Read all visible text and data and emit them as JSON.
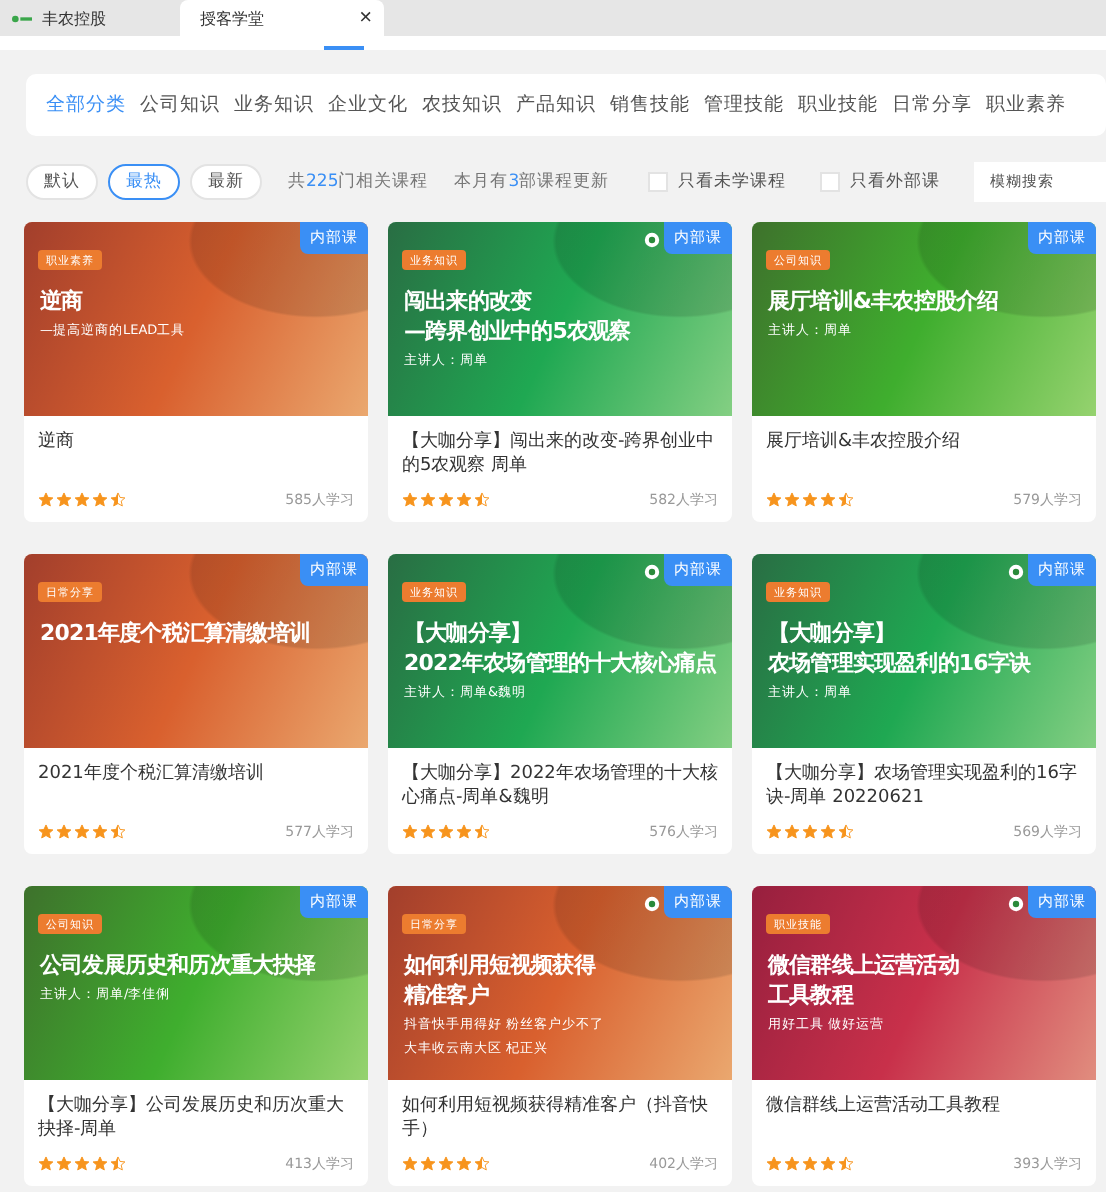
{
  "window_tabs": [
    {
      "label": "丰农控股",
      "selected": false,
      "has_logo": true
    },
    {
      "label": "授客学堂",
      "selected": true,
      "has_logo": false
    }
  ],
  "close_symbol": "×",
  "categories": [
    {
      "label": "全部分类",
      "selected": true
    },
    {
      "label": "公司知识",
      "selected": false
    },
    {
      "label": "业务知识",
      "selected": false
    },
    {
      "label": "企业文化",
      "selected": false
    },
    {
      "label": "农技知识",
      "selected": false
    },
    {
      "label": "产品知识",
      "selected": false
    },
    {
      "label": "销售技能",
      "selected": false
    },
    {
      "label": "管理技能",
      "selected": false
    },
    {
      "label": "职业技能",
      "selected": false
    },
    {
      "label": "日常分享",
      "selected": false
    },
    {
      "label": "职业素养",
      "selected": false
    }
  ],
  "sort_buttons": [
    {
      "label": "默认",
      "selected": false
    },
    {
      "label": "最热",
      "selected": true
    },
    {
      "label": "最新",
      "selected": false
    }
  ],
  "total": {
    "prefix": "共",
    "number": "225",
    "suffix": "门相关课程"
  },
  "monthly": {
    "prefix": "本月有",
    "number": "3",
    "suffix": "部课程更新"
  },
  "filters": [
    {
      "label": "只看未学课程",
      "checked": false
    },
    {
      "label": "只看外部课",
      "checked": false
    }
  ],
  "search_mode": {
    "value": "模糊搜索"
  },
  "courses": [
    {
      "cover": {
        "color": "#d9602e",
        "tag": "职业素养",
        "badge": "内部课",
        "has_logo": false,
        "lines": [
          "逆商"
        ],
        "sub": [
          "—提高逆商的LEAD工具"
        ]
      },
      "title": "逆商",
      "stars": 4.5,
      "learners": "585人学习"
    },
    {
      "cover": {
        "color": "#1fa852",
        "tag": "业务知识",
        "badge": "内部课",
        "has_logo": true,
        "lines": [
          "闯出来的改变",
          "—跨界创业中的5农观察"
        ],
        "sub": [
          "主讲人：周单"
        ]
      },
      "title": "【大咖分享】闯出来的改变-跨界创业中的5农观察 周单",
      "stars": 4.5,
      "learners": "582人学习"
    },
    {
      "cover": {
        "color": "#3fae2e",
        "tag": "公司知识",
        "badge": "内部课",
        "has_logo": false,
        "lines": [
          "展厅培训&丰农控股介绍"
        ],
        "sub": [
          "主讲人：周单"
        ]
      },
      "title": "展厅培训&丰农控股介绍",
      "stars": 4.5,
      "learners": "579人学习"
    },
    {
      "cover": {
        "color": "#d9602e",
        "tag": "日常分享",
        "badge": "内部课",
        "has_logo": false,
        "lines": [
          "2021年度个税汇算清缴培训"
        ]
      },
      "title": "2021年度个税汇算清缴培训",
      "stars": 4.5,
      "learners": "577人学习"
    },
    {
      "cover": {
        "color": "#1fa852",
        "tag": "业务知识",
        "badge": "内部课",
        "has_logo": true,
        "lines": [
          "【大咖分享】",
          "2022年农场管理的十大核心痛点"
        ],
        "sub": [
          "主讲人：周单&魏明"
        ]
      },
      "title": "【大咖分享】2022年农场管理的十大核心痛点-周单&魏明",
      "stars": 4.5,
      "learners": "576人学习"
    },
    {
      "cover": {
        "color": "#1fa852",
        "tag": "业务知识",
        "badge": "内部课",
        "has_logo": true,
        "lines": [
          "【大咖分享】",
          "农场管理实现盈利的16字诀"
        ],
        "sub": [
          "主讲人：周单"
        ]
      },
      "title": "【大咖分享】农场管理实现盈利的16字诀-周单 20220621",
      "stars": 4.5,
      "learners": "569人学习"
    },
    {
      "cover": {
        "color": "#3fae2e",
        "tag": "公司知识",
        "badge": "内部课",
        "has_logo": false,
        "lines": [
          "公司发展历史和历次重大抉择"
        ],
        "sub": [
          "主讲人：周单/李佳俐"
        ]
      },
      "title": "【大咖分享】公司发展历史和历次重大抉择-周单",
      "stars": 4.5,
      "learners": "413人学习"
    },
    {
      "cover": {
        "color": "#d9602e",
        "tag": "日常分享",
        "badge": "内部课",
        "has_logo": true,
        "lines": [
          "如何利用短视频获得",
          "精准客户"
        ],
        "sub": [
          "抖音快手用得好  粉丝客户少不了",
          "大丰收云南大区  杞正兴"
        ]
      },
      "title": "如何利用短视频获得精准客户（抖音快手）",
      "stars": 4.5,
      "learners": "402人学习"
    },
    {
      "cover": {
        "color": "#c8304a",
        "tag": "职业技能",
        "badge": "内部课",
        "has_logo": true,
        "lines": [
          "微信群线上运营活动",
          "工具教程"
        ],
        "sub": [
          "用好工具  做好运营"
        ]
      },
      "title": "微信群线上运营活动工具教程",
      "stars": 4.5,
      "learners": "393人学习"
    }
  ]
}
